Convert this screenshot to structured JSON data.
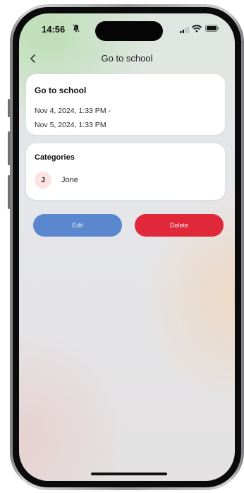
{
  "status_bar": {
    "time": "14:56"
  },
  "nav": {
    "title": "Go to school"
  },
  "event": {
    "title": "Go to school",
    "start": "Nov 4, 2024, 1:33 PM -",
    "end": "Nov 5, 2024, 1:33 PM"
  },
  "categories": {
    "title": "Categories",
    "items": [
      {
        "initial": "J",
        "name": "Jone"
      }
    ]
  },
  "actions": {
    "edit_label": "Edit",
    "delete_label": "Delete"
  },
  "colors": {
    "edit_button": "#5b87cf",
    "delete_button": "#e0283a",
    "avatar_bg": "#fde2e2",
    "card_bg": "#ffffff"
  },
  "icons": {
    "back": "chevron-left-icon",
    "silent": "bell-slash-icon",
    "signal": "signal-icon",
    "wifi": "wifi-icon",
    "battery": "battery-icon"
  }
}
